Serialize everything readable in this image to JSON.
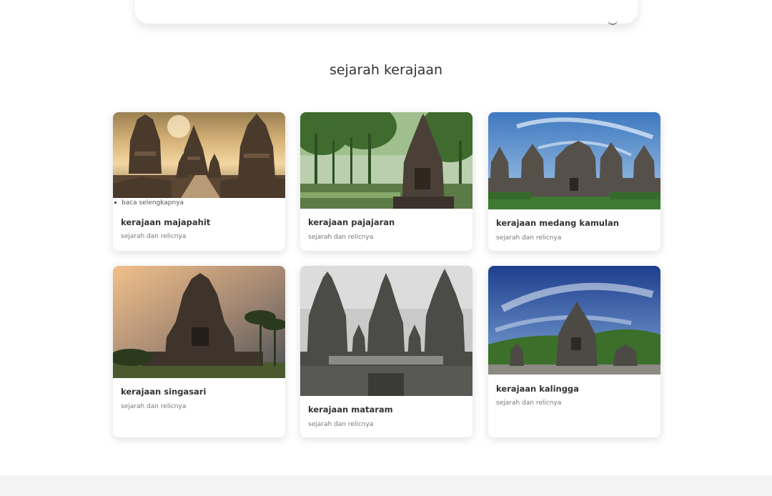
{
  "section": {
    "title": "sejarah kerajaan"
  },
  "cards": [
    {
      "title": "kerajaan majapahit",
      "subtitle": "sejarah dan relicnya",
      "read_more": "baca selengkapnya"
    },
    {
      "title": "kerajaan pajajaran",
      "subtitle": "sejarah dan relicnya"
    },
    {
      "title": "kerajaan medang kamulan",
      "subtitle": "sejarah dan relicnya"
    },
    {
      "title": "kerajaan singasari",
      "subtitle": "sejarah dan relicnya"
    },
    {
      "title": "kerajaan mataram",
      "subtitle": "sejarah dan relicnya"
    },
    {
      "title": "kerajaan kalingga",
      "subtitle": "sejarah dan relicnya"
    }
  ],
  "colors": {
    "text": "#333333",
    "muted": "#777777",
    "footer_bg": "#f3f3f4"
  }
}
